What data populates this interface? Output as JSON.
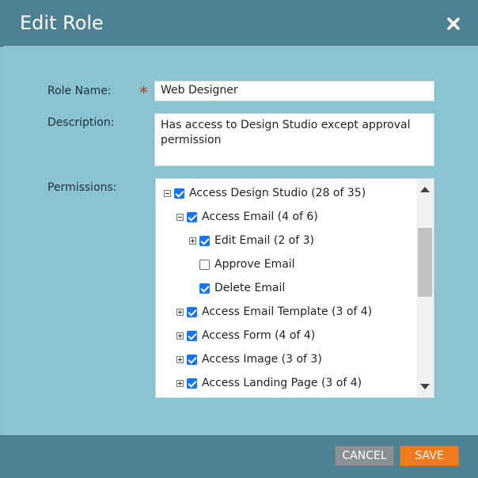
{
  "dialog": {
    "title": "Edit Role",
    "close_icon": "close-icon"
  },
  "form": {
    "role_name_label": "Role Name:",
    "required_marker": "*",
    "role_name_value": "Web Designer",
    "description_label": "Description:",
    "description_value": "Has access to Design Studio except approval permission",
    "permissions_label": "Permissions:"
  },
  "permissions": [
    {
      "label": "Access Design Studio (28 of 35)",
      "level": 0,
      "expander": "minus",
      "checked": true
    },
    {
      "label": "Access Email (4 of 6)",
      "level": 1,
      "expander": "minus",
      "checked": true
    },
    {
      "label": "Edit Email (2 of 3)",
      "level": 2,
      "expander": "plus",
      "checked": true
    },
    {
      "label": "Approve Email",
      "level": 2,
      "expander": "none",
      "checked": false
    },
    {
      "label": "Delete Email",
      "level": 2,
      "expander": "none",
      "checked": true
    },
    {
      "label": "Access Email Template (3 of 4)",
      "level": 1,
      "expander": "plus",
      "checked": true
    },
    {
      "label": "Access Form (4 of 4)",
      "level": 1,
      "expander": "plus",
      "checked": true
    },
    {
      "label": "Access Image (3 of 3)",
      "level": 1,
      "expander": "plus",
      "checked": true
    },
    {
      "label": "Access Landing Page (3 of 4)",
      "level": 1,
      "expander": "plus",
      "checked": true
    }
  ],
  "buttons": {
    "cancel": "CANCEL",
    "save": "SAVE"
  },
  "colors": {
    "header": "#4d8193",
    "body": "#8ac3d1",
    "save": "#f07a1f",
    "cancel": "#8b9094",
    "checkbox": "#1a73e8"
  }
}
